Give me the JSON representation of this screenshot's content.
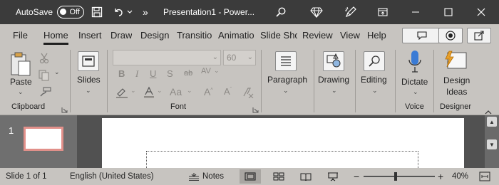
{
  "titlebar": {
    "autosave_label": "AutoSave",
    "autosave_state": "Off",
    "more_label": "»",
    "document_title": "Presentation1  -  Power..."
  },
  "tabs": [
    {
      "label": "File"
    },
    {
      "label": "Home"
    },
    {
      "label": "Insert"
    },
    {
      "label": "Draw"
    },
    {
      "label": "Design"
    },
    {
      "label": "Transitio"
    },
    {
      "label": "Animatio"
    },
    {
      "label": "Slide Sho"
    },
    {
      "label": "Review"
    },
    {
      "label": "View"
    },
    {
      "label": "Help"
    }
  ],
  "ribbon": {
    "clipboard": {
      "paste_label": "Paste",
      "group_label": "Clipboard"
    },
    "slides": {
      "label": "Slides"
    },
    "font": {
      "font_size_value": "60",
      "group_label": "Font"
    },
    "paragraph": {
      "label": "Paragraph"
    },
    "drawing": {
      "label": "Drawing"
    },
    "editing": {
      "label": "Editing"
    },
    "voice": {
      "dictate_label": "Dictate",
      "group_label": "Voice"
    },
    "designer": {
      "label_line1": "Design",
      "label_line2": "Ideas",
      "group_label": "Designer"
    }
  },
  "editor": {
    "slide_number": "1"
  },
  "statusbar": {
    "slide_info": "Slide 1 of 1",
    "language": "English (United States)",
    "notes_label": "Notes",
    "zoom_minus": "−",
    "zoom_plus": "+",
    "zoom_level": "40%"
  },
  "colors": {
    "titlebar_bg": "#3b3b3b",
    "ribbon_bg": "#c7c4c0",
    "editor_bg": "#515151",
    "thumb_border": "#e2908a"
  }
}
